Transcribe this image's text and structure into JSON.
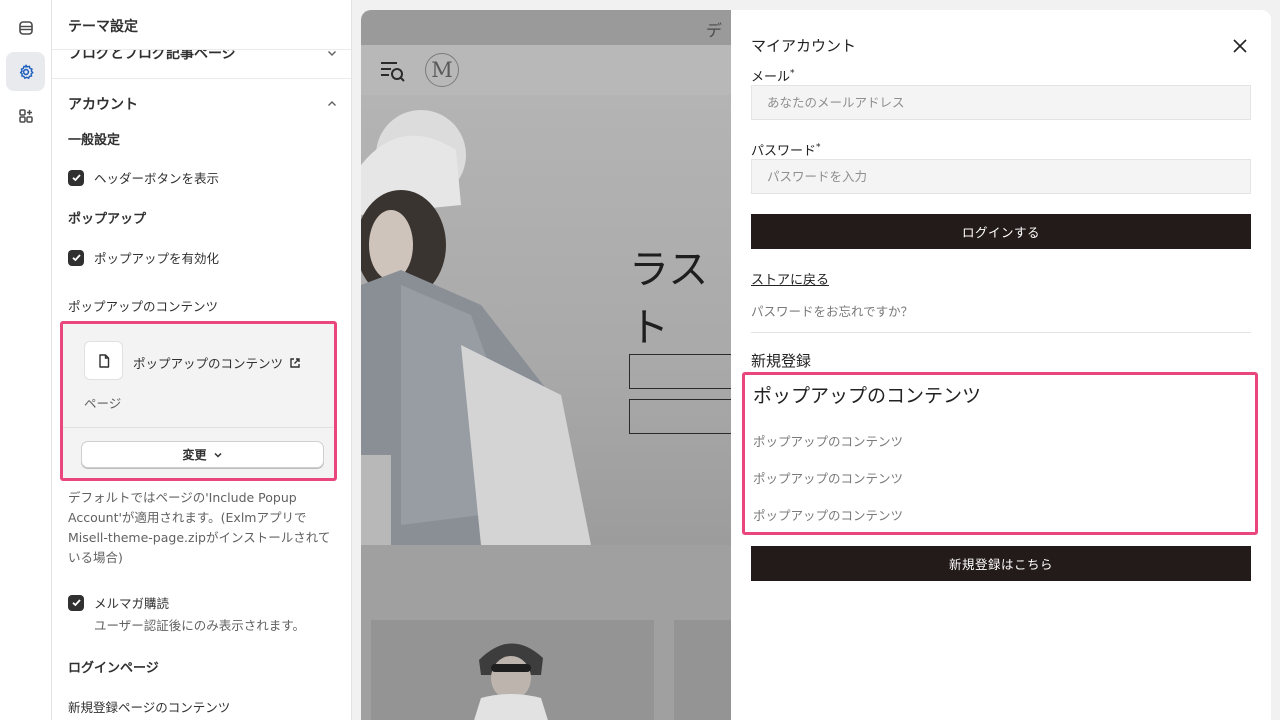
{
  "rail": {
    "items": [
      {
        "icon": "sections-icon",
        "active": false
      },
      {
        "icon": "gear-icon",
        "active": true
      },
      {
        "icon": "apps-icon",
        "active": false
      }
    ]
  },
  "panel": {
    "title": "テーマ設定",
    "collapsed_section": "ブログとブログ記事ページ",
    "account_section": "アカウント",
    "general_heading": "一般設定",
    "show_header_button": "ヘッダーボタンを表示",
    "popup_heading": "ポップアップ",
    "enable_popup": "ポップアップを有効化",
    "popup_content_label": "ポップアップのコンテンツ",
    "picker": {
      "title": "ポップアップのコンテンツ",
      "type": "ページ",
      "change_label": "変更"
    },
    "help_text": "デフォルトではページの'Include Popup Account'が適用されます。(Exlmアプリで Misell-theme-page.zipがインストールされている場合)",
    "newsletter": "メルマガ購読",
    "newsletter_help": "ユーザー認証後にのみ表示されます。",
    "login_page_heading": "ログインページ",
    "register_page_content": "新規登録ページのコンテンツ"
  },
  "preview": {
    "announcement": "デ",
    "logo_letter": "M",
    "hero_text": "ラスト"
  },
  "drawer": {
    "title": "マイアカウント",
    "email_label": "メール",
    "email_placeholder": "あなたのメールアドレス",
    "password_label": "パスワード",
    "password_placeholder": "パスワードを入力",
    "required_mark": "*",
    "login_button": "ログインする",
    "back_to_store": "ストアに戻る",
    "forgot_password": "パスワードをお忘れですか？",
    "register_title": "新規登録",
    "popup_heading": "ポップアップのコンテンツ",
    "popup_lines": [
      "ポップアップのコンテンツ",
      "ポップアップのコンテンツ",
      "ポップアップのコンテンツ"
    ],
    "register_button": "新規登録はこちら"
  },
  "colors": {
    "highlight": "#e8467c",
    "dark_button": "#231a1a"
  }
}
